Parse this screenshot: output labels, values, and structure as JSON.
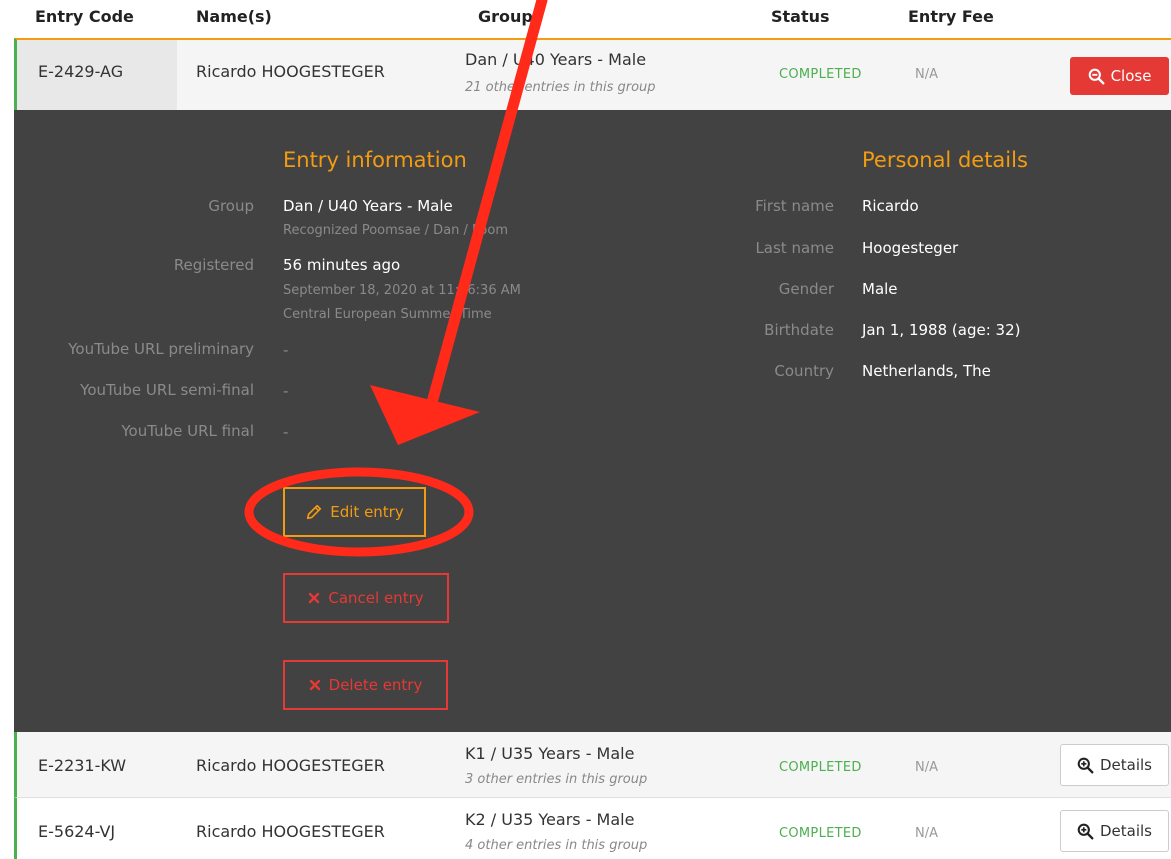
{
  "header": {
    "entry_code": "Entry Code",
    "names": "Name(s)",
    "group": "Group",
    "status": "Status",
    "entry_fee": "Entry Fee"
  },
  "expanded_row": {
    "code": "E-2429-AG",
    "name": "Ricardo HOOGESTEGER",
    "group": "Dan / U40 Years - Male",
    "group_sub": "21 other entries in this group",
    "status": "COMPLETED",
    "fee": "N/A",
    "close_label": "Close"
  },
  "entry_info": {
    "title": "Entry information",
    "group_label": "Group",
    "group_value": "Dan / U40 Years - Male",
    "group_sub": "Recognized Poomsae / Dan / Poom",
    "registered_label": "Registered",
    "registered_value": "56 minutes ago",
    "registered_date": "September 18, 2020 at 11:26:36 AM",
    "registered_tz": "Central European Summer Time",
    "yt_pre_label": "YouTube URL preliminary",
    "yt_pre_value": "-",
    "yt_semi_label": "YouTube URL semi-final",
    "yt_semi_value": "-",
    "yt_final_label": "YouTube URL final",
    "yt_final_value": "-",
    "edit_label": "Edit entry",
    "cancel_label": "Cancel entry",
    "delete_label": "Delete entry"
  },
  "personal": {
    "title": "Personal details",
    "first_label": "First name",
    "first_value": "Ricardo",
    "last_label": "Last name",
    "last_value": "Hoogesteger",
    "gender_label": "Gender",
    "gender_value": "Male",
    "birth_label": "Birthdate",
    "birth_value": "Jan 1, 1988 (age: 32)",
    "country_label": "Country",
    "country_value": "Netherlands, The"
  },
  "rows": [
    {
      "code": "E-2231-KW",
      "name": "Ricardo HOOGESTEGER",
      "group": "K1 / U35 Years - Male",
      "group_sub": "3 other entries in this group",
      "status": "COMPLETED",
      "fee": "N/A",
      "details_label": "Details"
    },
    {
      "code": "E-5624-VJ",
      "name": "Ricardo HOOGESTEGER",
      "group": "K2 / U35 Years - Male",
      "group_sub": "4 other entries in this group",
      "status": "COMPLETED",
      "fee": "N/A",
      "details_label": "Details"
    }
  ],
  "colors": {
    "accent": "#f39c12",
    "danger": "#e53935",
    "success": "#4caf50",
    "panel": "#424242",
    "annotation": "#ff2a1a"
  },
  "icons": {
    "close": "zoom-out-icon",
    "edit": "pencil-icon",
    "cancel": "x-icon",
    "delete": "x-icon",
    "details": "zoom-in-icon"
  }
}
